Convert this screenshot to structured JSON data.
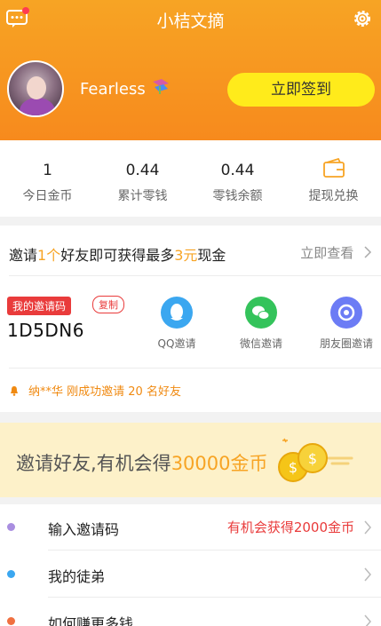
{
  "header": {
    "title": "小桔文摘",
    "username": "Fearless",
    "sign_in_label": "立即签到",
    "colors": {
      "orange": "#f7a424",
      "sign_button": "#ffeb1b"
    }
  },
  "stats": [
    {
      "value": "1",
      "label": "今日金币"
    },
    {
      "value": "0.44",
      "label": "累计零钱"
    },
    {
      "value": "0.44",
      "label": "零钱余额"
    },
    {
      "label": "提现兑换",
      "icon": "wallet-icon"
    }
  ],
  "invite": {
    "line": {
      "p1": "邀请",
      "n1": "1个",
      "p2": "好友即可获得最多",
      "n2": "3元",
      "p3": "现金"
    },
    "view_label": "立即查看",
    "code_tag": "我的邀请码",
    "copy_label": "复制",
    "code": "1D5DN6",
    "share": [
      {
        "label": "QQ邀请",
        "icon": "qq-icon",
        "color": "#3ba7f0"
      },
      {
        "label": "微信邀请",
        "icon": "wechat-icon",
        "color": "#34c35b"
      },
      {
        "label": "朋友圈邀请",
        "icon": "moments-icon",
        "color": "#6c7cf5"
      }
    ],
    "notice": "纳**华 刚成功邀请 20 名好友"
  },
  "banner": {
    "prefix": "邀请好友,有机会得",
    "amount": "30000金币"
  },
  "menu": [
    {
      "label": "输入邀请码",
      "value": "有机会获得2000金币",
      "dot_color": "#a98ee0"
    },
    {
      "label": "我的徒弟",
      "value": "",
      "dot_color": "#3ba7f0"
    },
    {
      "label": "如何赚更多钱",
      "value": "",
      "dot_color": "#f07040"
    }
  ]
}
